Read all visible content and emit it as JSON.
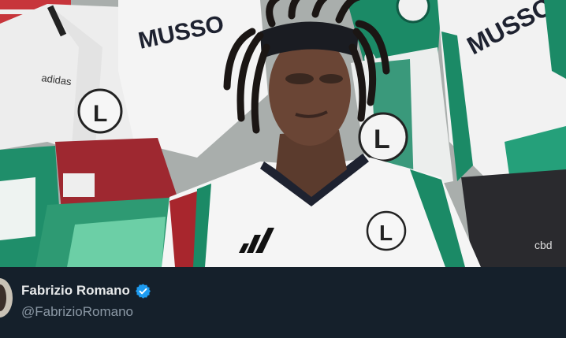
{
  "post": {
    "author": {
      "display_name": "Fabrizio Romano",
      "handle": "@FabrizioRomano",
      "verified": true,
      "verified_icon": "verified-badge-icon"
    }
  },
  "media": {
    "shirt_lettering_left": "MUSSO",
    "shirt_lettering_right": "MUSSO",
    "shirt_brand": "adidas",
    "crest_letter": "L",
    "small_print": "cbd"
  },
  "colors": {
    "background": "#15202b",
    "name_text": "#e7e9ea",
    "handle_text": "#8b98a5",
    "verified_blue": "#1d9bf0",
    "kit_white": "#f1f1f1",
    "kit_green": "#1b8a66",
    "kit_red": "#b0232b"
  }
}
